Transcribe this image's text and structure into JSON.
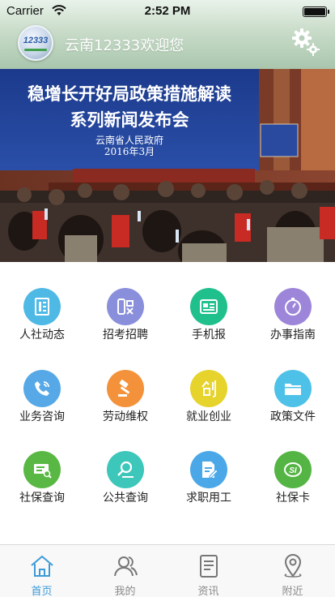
{
  "status_bar": {
    "carrier": "Carrier",
    "time": "2:52 PM"
  },
  "header": {
    "logo_text": "12333",
    "title": "云南12333欢迎您",
    "settings_icon": "gear-icon"
  },
  "banner": {
    "headline_line1": "稳增长开好局政策措施解读",
    "headline_line2": "系列新闻发布会",
    "org": "云南省人民政府",
    "date": "2016年3月"
  },
  "grid": {
    "items": [
      {
        "label": "人社动态",
        "icon": "news-icon",
        "color": "#4fb9e6"
      },
      {
        "label": "招考招聘",
        "icon": "recruit-icon",
        "color": "#8a8fdc"
      },
      {
        "label": "手机报",
        "icon": "newspaper-icon",
        "color": "#20c08c"
      },
      {
        "label": "办事指南",
        "icon": "compass-icon",
        "color": "#9d86d9"
      },
      {
        "label": "业务咨询",
        "icon": "phone-icon",
        "color": "#56a9e6"
      },
      {
        "label": "劳动维权",
        "icon": "gavel-icon",
        "color": "#f3923a"
      },
      {
        "label": "就业创业",
        "icon": "startup-icon",
        "color": "#e6d32c"
      },
      {
        "label": "政策文件",
        "icon": "folder-icon",
        "color": "#4ec1e8"
      },
      {
        "label": "社保查询",
        "icon": "card-search-icon",
        "color": "#59b843"
      },
      {
        "label": "公共查询",
        "icon": "magnifier-icon",
        "color": "#3cc7ba"
      },
      {
        "label": "求职用工",
        "icon": "resume-icon",
        "color": "#4aa8e8"
      },
      {
        "label": "社保卡",
        "icon": "si-card-icon",
        "color": "#55b544"
      }
    ]
  },
  "tabbar": {
    "tabs": [
      {
        "label": "首页",
        "icon": "home-icon",
        "active": true
      },
      {
        "label": "我的",
        "icon": "user-icon",
        "active": false
      },
      {
        "label": "资讯",
        "icon": "news-doc-icon",
        "active": false
      },
      {
        "label": "附近",
        "icon": "location-icon",
        "active": false
      }
    ]
  },
  "colors": {
    "accent": "#3c9ad8",
    "tab_inactive": "#8a8a8a"
  }
}
